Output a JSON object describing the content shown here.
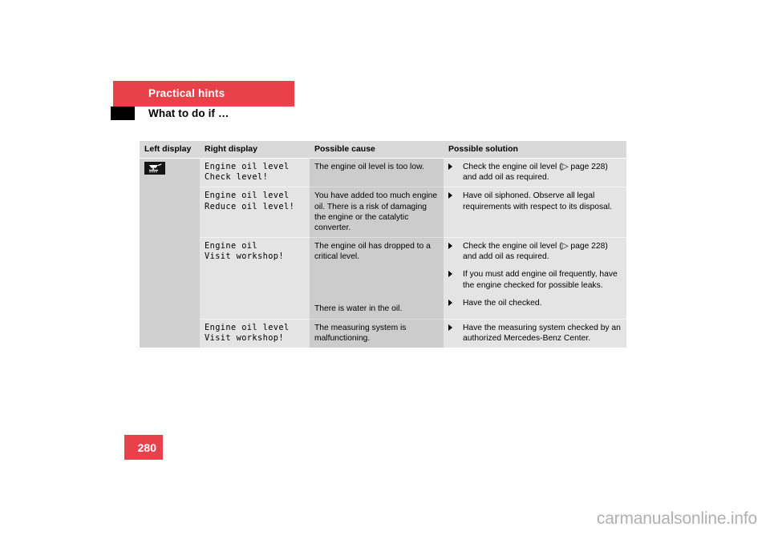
{
  "header": {
    "chapter": "Practical hints",
    "section": "What to do if …"
  },
  "table": {
    "columns": [
      "Left display",
      "Right display",
      "Possible cause",
      "Possible solution"
    ],
    "left_display_icon": "oil-level-warning-icon",
    "rows": [
      {
        "right_display_line1": "Engine oil level",
        "right_display_line2": "Check level!",
        "cause": "The engine oil level is too low.",
        "cause_secondary": "",
        "solutions": [
          "Check the engine oil level (▷ page 228) and add oil as required."
        ]
      },
      {
        "right_display_line1": "Engine oil level",
        "right_display_line2": "Reduce oil level!",
        "cause": "You have added too much engine oil. There is a risk of damaging the engine or the catalytic converter.",
        "cause_secondary": "",
        "solutions": [
          "Have oil siphoned. Observe all legal requirements with respect to its disposal."
        ]
      },
      {
        "right_display_line1": "Engine oil",
        "right_display_line2": "Visit workshop!",
        "cause": "The engine oil has dropped to a critical level.",
        "cause_secondary": "There is water in the oil.",
        "solutions": [
          "Check the engine oil level (▷ page 228) and add oil as required.",
          "If you must add engine oil frequently, have the engine checked for possible leaks.",
          "Have the oil checked."
        ]
      },
      {
        "right_display_line1": "Engine oil level",
        "right_display_line2": "Visit workshop!",
        "cause": "The measuring system is malfunctioning.",
        "cause_secondary": "",
        "solutions": [
          "Have the measuring system checked by an authorized Mercedes-Benz Center."
        ]
      }
    ]
  },
  "footer": {
    "page_number": "280",
    "watermark": "carmanualsonline.info"
  },
  "colors": {
    "accent_red": "#e8414a",
    "header_gray": "#d9d9d9",
    "left_col_gray": "#d0d0d0",
    "cause_col_gray": "#cccccc",
    "light_col_gray": "#e4e4e4",
    "display_text_gray": "#8c8c8c"
  }
}
